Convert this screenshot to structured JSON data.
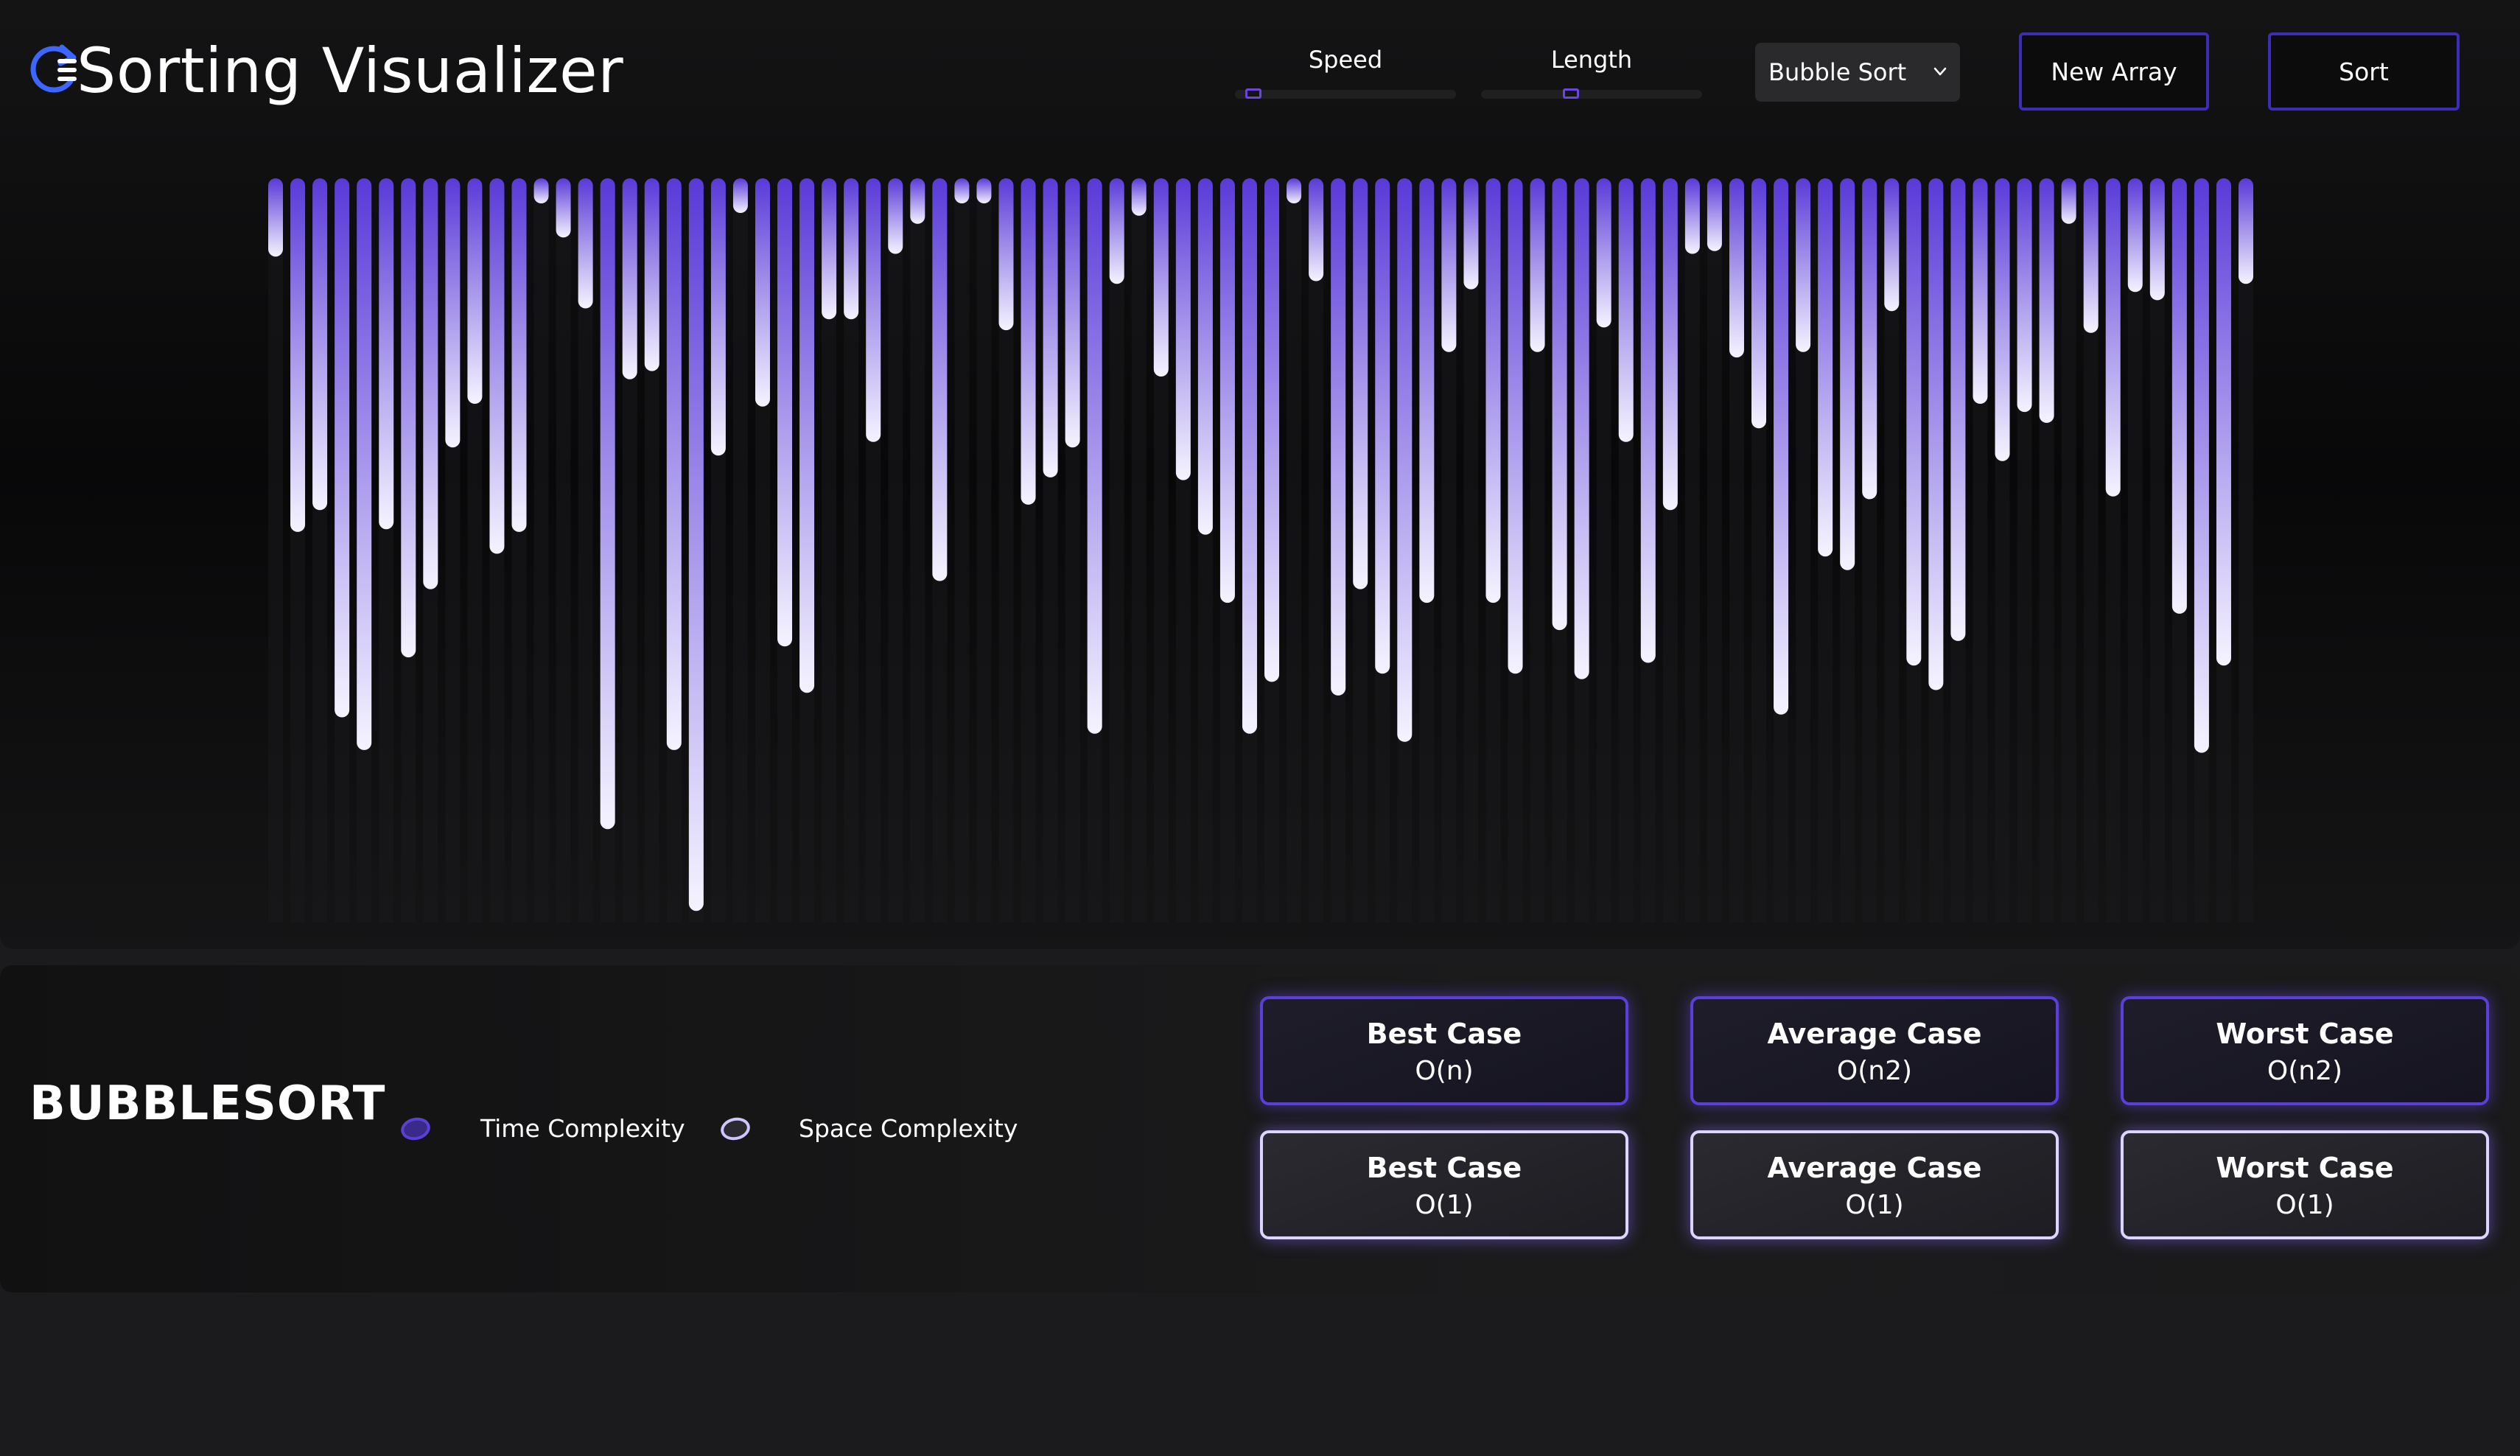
{
  "app": {
    "title": "Sorting Visualizer"
  },
  "controls": {
    "speed_label": "Speed",
    "speed_value": 0.05,
    "length_label": "Length",
    "length_value": 0.4,
    "algorithm_selected": "Bubble Sort",
    "new_array_label": "New Array",
    "sort_label": "Sort"
  },
  "colors": {
    "accent": "#5a3ad8",
    "bar_top": "#5a3ad8",
    "bar_bottom": "#f5f3ff",
    "background": "#0a0a0b"
  },
  "bars": {
    "values": [
      26,
      127,
      119,
      195,
      207,
      126,
      173,
      148,
      96,
      80,
      135,
      127,
      3,
      19,
      45,
      236,
      71,
      68,
      207,
      266,
      99,
      10,
      81,
      169,
      186,
      49,
      49,
      94,
      25,
      14,
      145,
      3,
      3,
      53,
      117,
      107,
      96,
      201,
      36,
      11,
      70,
      108,
      128,
      153,
      201,
      182,
      4,
      35,
      187,
      148,
      179,
      204,
      153,
      61,
      38,
      153,
      179,
      61,
      163,
      181,
      52,
      94,
      175,
      119,
      25,
      24,
      63,
      89,
      194,
      61,
      136,
      141,
      115,
      46,
      176,
      185,
      167,
      80,
      101,
      83,
      87,
      14,
      54,
      114,
      39,
      42,
      157,
      208,
      176,
      36
    ]
  },
  "info": {
    "algorithm_name": "BUBBLESORT",
    "time_legend": "Time Complexity",
    "space_legend": "Space Complexity",
    "time": {
      "best_title": "Best Case",
      "best_value": "O(n)",
      "average_title": "Average Case",
      "average_value": "O(n2)",
      "worst_title": "Worst Case",
      "worst_value": "O(n2)"
    },
    "space": {
      "best_title": "Best Case",
      "best_value": "O(1)",
      "average_title": "Average Case",
      "average_value": "O(1)",
      "worst_title": "Worst Case",
      "worst_value": "O(1)"
    }
  }
}
